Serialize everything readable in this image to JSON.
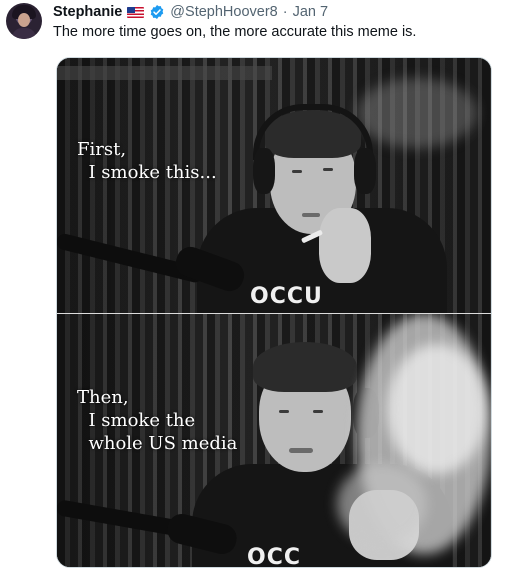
{
  "tweet": {
    "author_name": "Stephanie",
    "handle": "@StephHoover8",
    "separator": "·",
    "date": "Jan 7",
    "text": "The more time goes on, the more accurate this meme is.",
    "icons": {
      "flag": "us-flag-icon",
      "verified": "verified-badge-icon"
    },
    "colors": {
      "verified": "#1d9bf0",
      "secondary_text": "#536471"
    }
  },
  "meme": {
    "top_panel": {
      "caption_line1": "First,",
      "caption_line2": "  I smoke this...",
      "shirt_text": "OCCU"
    },
    "bottom_panel": {
      "caption_line1": "Then,",
      "caption_line2": "  I smoke the",
      "caption_line3": "  whole US media",
      "shirt_text": "OCC"
    }
  }
}
